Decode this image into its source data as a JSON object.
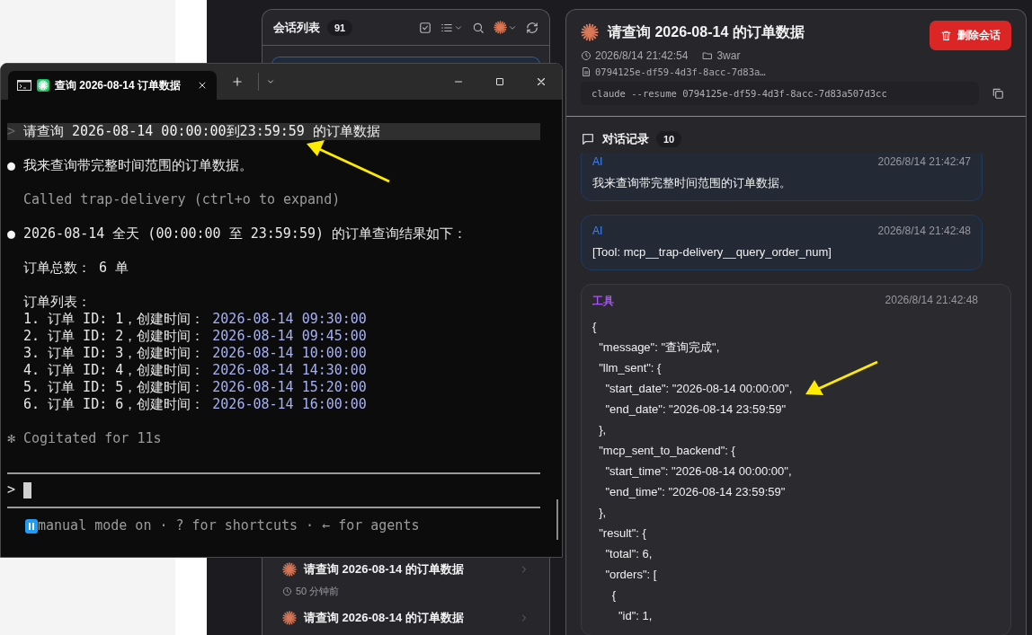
{
  "session_list": {
    "title": "会话列表",
    "count": "91",
    "items": [
      {
        "selected": true
      },
      {
        "selected": false,
        "title": "请查询 2026-08-14 的订单数据",
        "time": "50 分钟前"
      },
      {
        "selected": false,
        "title": "请查询 2026-08-14 的订单数据"
      }
    ]
  },
  "detail": {
    "title": "请查询 2026-08-14 的订单数据",
    "delete_label": "删除会话",
    "created": "2026/8/14 21:42:54",
    "folder": "3war",
    "file": "0794125e-df59-4d3f-8acc-7d83a…",
    "command": "claude --resume 0794125e-df59-4d3f-8acc-7d83a507d3cc",
    "history": {
      "title": "对话记录",
      "count": "10",
      "messages": [
        {
          "kind": "ai",
          "role": "AI",
          "time": "2026/8/14 21:42:47",
          "lines": [
            "我来查询带完整时间范围的订单数据。"
          ]
        },
        {
          "kind": "ai",
          "role": "AI",
          "time": "2026/8/14 21:42:48",
          "lines": [
            "[Tool: mcp__trap-delivery__query_order_num]"
          ]
        },
        {
          "kind": "tool",
          "role": "工具",
          "time": "2026/8/14 21:42:48",
          "lines": [
            "{",
            "  \"message\": \"查询完成\",",
            "  \"llm_sent\": {",
            "    \"start_date\": \"2026-08-14 00:00:00\",",
            "    \"end_date\": \"2026-08-14 23:59:59\"",
            "  },",
            "  \"mcp_sent_to_backend\": {",
            "    \"start_time\": \"2026-08-14 00:00:00\",",
            "    \"end_time\": \"2026-08-14 23:59:59\"",
            "  },",
            "  \"result\": {",
            "    \"total\": 6,",
            "    \"orders\": [",
            "      {",
            "        \"id\": 1,"
          ]
        }
      ]
    }
  },
  "terminal": {
    "tab_title": "查询 2026-08-14 订单数据",
    "lines": [
      {
        "kind": "prompt",
        "marker": ">",
        "text": "请查询 2026-08-14 00:00:00到23:59:59 的订单数据"
      },
      {
        "kind": "bullet",
        "marker": "●",
        "text": "我来查询带完整时间范围的订单数据。"
      },
      {
        "kind": "dim",
        "text": "Called trap-delivery (ctrl+o to expand)"
      },
      {
        "kind": "bullet",
        "marker": "●",
        "text": "2026-08-14 全天 (00:00:00 至 23:59:59) 的订单查询结果如下："
      },
      {
        "kind": "text",
        "text": "订单总数： 6 单"
      },
      {
        "kind": "text",
        "text": "订单列表："
      },
      {
        "kind": "order",
        "text": "1. 订单 ID: 1，创建时间：",
        "time": "2026-08-14 09:30:00"
      },
      {
        "kind": "order",
        "text": "2. 订单 ID: 2，创建时间：",
        "time": "2026-08-14 09:45:00"
      },
      {
        "kind": "order",
        "text": "3. 订单 ID: 3，创建时间：",
        "time": "2026-08-14 10:00:00"
      },
      {
        "kind": "order",
        "text": "4. 订单 ID: 4，创建时间：",
        "time": "2026-08-14 14:30:00"
      },
      {
        "kind": "order",
        "text": "5. 订单 ID: 5，创建时间：",
        "time": "2026-08-14 15:20:00"
      },
      {
        "kind": "order",
        "text": "6. 订单 ID: 6，创建时间：",
        "time": "2026-08-14 16:00:00"
      },
      {
        "kind": "thinking",
        "marker": "✻",
        "text": "Cogitated for 11s"
      }
    ],
    "input_prompt": ">",
    "status": "manual mode on · ? for shortcuts · ← for agents"
  }
}
